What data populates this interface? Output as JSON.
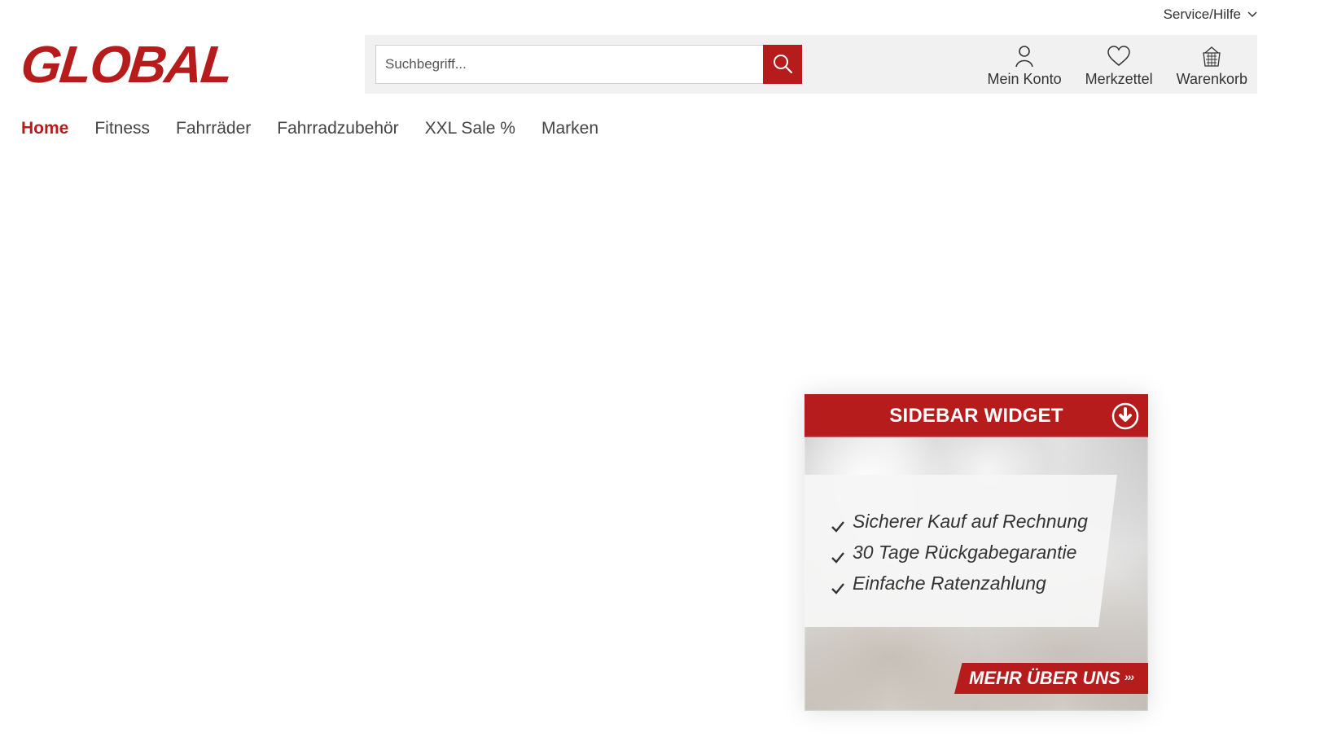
{
  "header": {
    "service_label": "Service/Hilfe",
    "logo_text": "GLOBAL",
    "search_placeholder": "Suchbegriff...",
    "actions": [
      {
        "label": "Mein Konto",
        "icon": "user-icon"
      },
      {
        "label": "Merkzettel",
        "icon": "heart-icon"
      },
      {
        "label": "Warenkorb",
        "icon": "basket-icon"
      }
    ]
  },
  "navigation": {
    "items": [
      {
        "label": "Home",
        "active": true
      },
      {
        "label": "Fitness"
      },
      {
        "label": "Fahrräder"
      },
      {
        "label": "Fahrradzubehör"
      },
      {
        "label": "XXL Sale %"
      },
      {
        "label": "Marken"
      }
    ]
  },
  "sidebar_widget": {
    "title": "SIDEBAR WIDGET",
    "benefits": [
      "Sicherer Kauf auf Rechnung",
      "30 Tage Rückgabegarantie",
      "Einfache Ratenzahlung"
    ],
    "button_label": "MEHR ÜBER UNS",
    "button_icon": "chevron-right-icon"
  },
  "colors": {
    "brand_red": "#b71c1c",
    "text": "#333333",
    "search_panel_background": "#f1f1f1"
  }
}
